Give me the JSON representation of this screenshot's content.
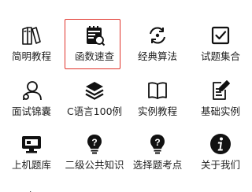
{
  "menu": {
    "items": [
      {
        "label": "简明教程",
        "icon": "books-icon"
      },
      {
        "label": "函数速查",
        "icon": "notebook-search-icon",
        "selected": true
      },
      {
        "label": "经典算法",
        "icon": "refresh-cycle-icon"
      },
      {
        "label": "试题集合",
        "icon": "checkbox-icon"
      },
      {
        "label": "面试锦囊",
        "icon": "user-icon"
      },
      {
        "label": "C语言100例",
        "icon": "layers-icon"
      },
      {
        "label": "实例教程",
        "icon": "open-book-icon"
      },
      {
        "label": "基础实例",
        "icon": "edit-note-icon"
      },
      {
        "label": "上机题库",
        "icon": "monitor-icon"
      },
      {
        "label": "二级公共知识",
        "icon": "lightbulb-question-icon"
      },
      {
        "label": "选择题考点",
        "icon": "lightbulb-question-icon"
      },
      {
        "label": "关于我们",
        "icon": "info-icon"
      }
    ],
    "highlight_color": "#e0322a"
  }
}
